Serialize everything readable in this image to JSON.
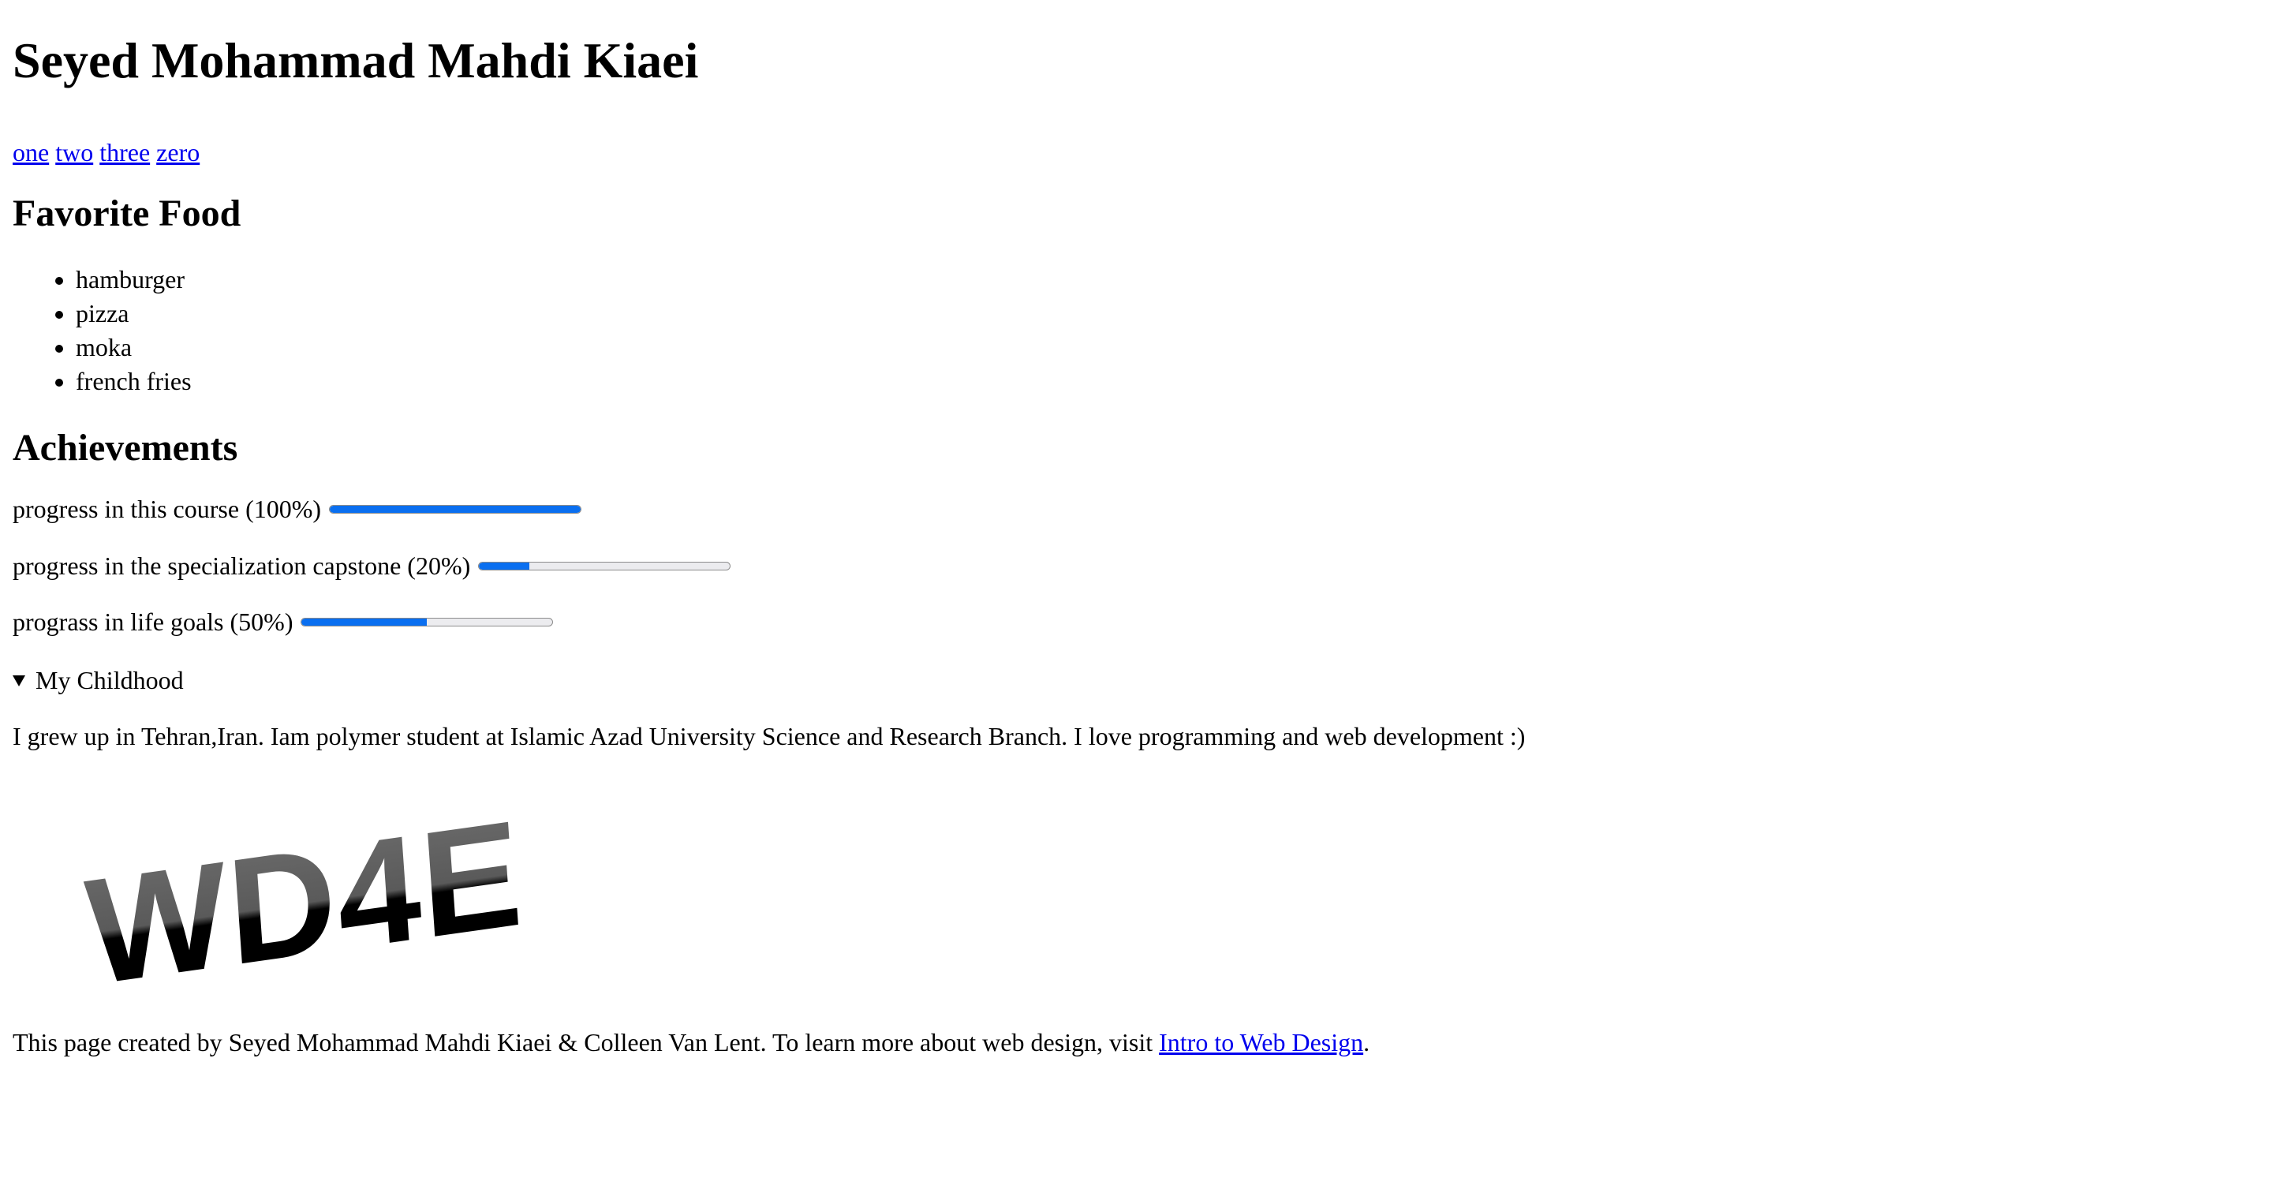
{
  "header": {
    "title": "Seyed Mohammad Mahdi Kiaei"
  },
  "nav": {
    "links": [
      "one",
      "two",
      "three",
      "zero"
    ]
  },
  "food": {
    "heading": "Favorite Food",
    "items": [
      "hamburger",
      "pizza",
      "moka",
      "french fries"
    ]
  },
  "achievements": {
    "heading": "Achievements",
    "items": [
      {
        "label": "progress in this course (100%)",
        "value": 1.0
      },
      {
        "label": "progress in the specialization capstone (20%)",
        "value": 0.2
      },
      {
        "label": "prograss in life goals (50%)",
        "value": 0.5
      }
    ]
  },
  "childhood": {
    "summary": "My Childhood",
    "text": "I grew up in Tehran,Iran. Iam polymer student at Islamic Azad University Science and Research Branch. I love programming and web development :)"
  },
  "logo": {
    "text": "WD4E"
  },
  "footer": {
    "prefix": "This page created by Seyed Mohammad Mahdi Kiaei & Colleen Van Lent. To learn more about web design, visit ",
    "link_text": "Intro to Web Design",
    "suffix": "."
  },
  "colors": {
    "link": "#0000ee",
    "progress_fill": "#0a6ff0",
    "progress_track": "#ececef"
  }
}
